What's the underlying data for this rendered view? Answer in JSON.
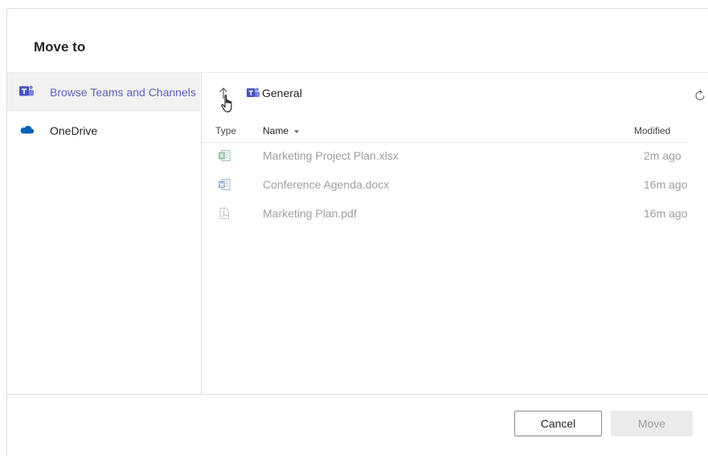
{
  "dialog": {
    "title": "Move to"
  },
  "nav": {
    "items": [
      {
        "label": "Browse Teams and Channels",
        "icon": "teams-icon",
        "active": true
      },
      {
        "label": "OneDrive",
        "icon": "onedrive-icon",
        "active": false
      }
    ]
  },
  "breadcrumb": {
    "current": "General",
    "icons": [
      "up-arrow-icon",
      "teams-icon",
      "refresh-icon"
    ]
  },
  "table": {
    "headers": {
      "type": "Type",
      "name": "Name",
      "modified": "Modified"
    },
    "sort_icon": "sort-down-caret-icon",
    "rows": [
      {
        "name": "Marketing Project Plan.xlsx",
        "modified": "2m ago",
        "icon": "excel-icon"
      },
      {
        "name": "Conference Agenda.docx",
        "modified": "16m ago",
        "icon": "word-icon"
      },
      {
        "name": "Marketing Plan.pdf",
        "modified": "16m ago",
        "icon": "pdf-icon"
      }
    ]
  },
  "footer": {
    "cancel_label": "Cancel",
    "move_label": "Move"
  },
  "colors": {
    "accent": "#5b5fc7",
    "teams": "#5059c9",
    "onedrive": "#0364b8",
    "excel": "#217346",
    "word": "#2b579a"
  }
}
